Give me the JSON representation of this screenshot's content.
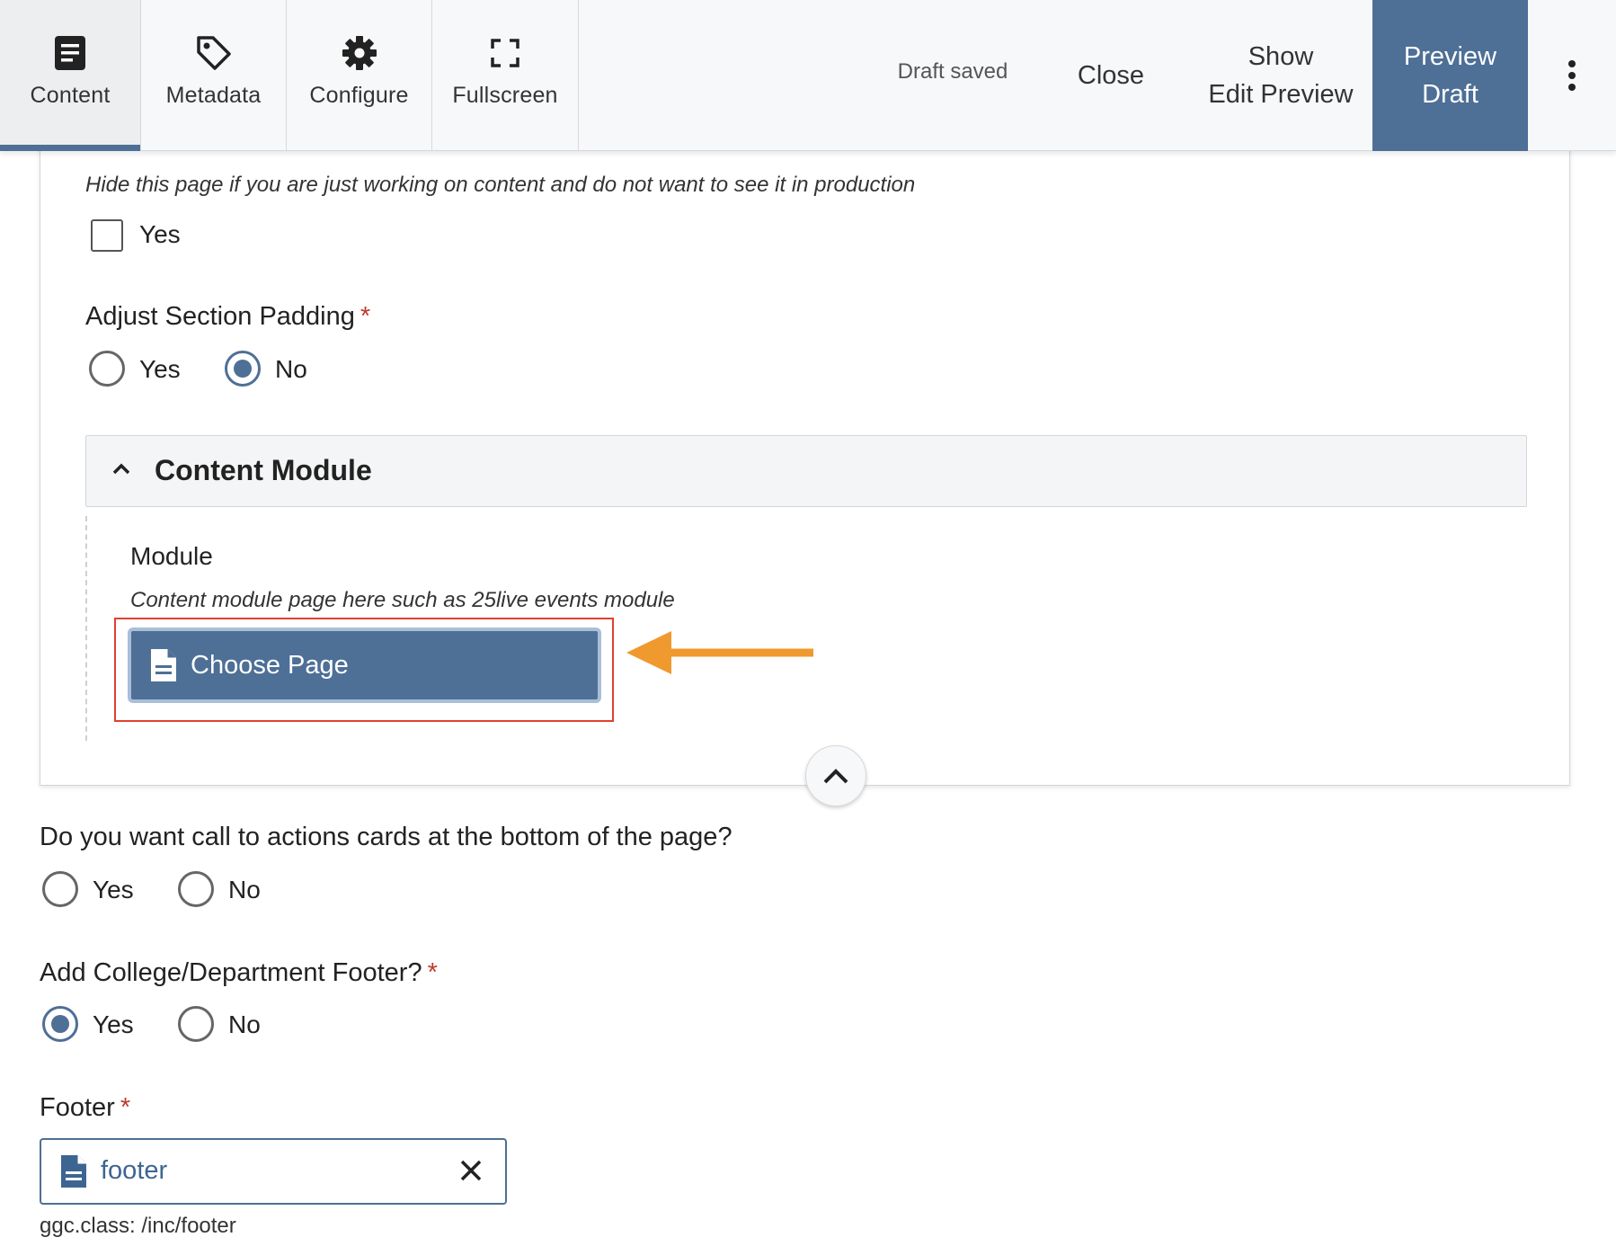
{
  "toolbar": {
    "tabs": [
      {
        "label": "Content",
        "icon": "content-document-icon",
        "active": true
      },
      {
        "label": "Metadata",
        "icon": "tag-icon",
        "active": false
      },
      {
        "label": "Configure",
        "icon": "gear-icon",
        "active": false
      },
      {
        "label": "Fullscreen",
        "icon": "fullscreen-icon",
        "active": false
      }
    ],
    "status": "Draft saved",
    "close_label": "Close",
    "show_preview": {
      "line1": "Show",
      "line2": "Edit Preview"
    },
    "preview_draft": {
      "line1": "Preview",
      "line2": "Draft"
    },
    "more_icon": "kebab-menu-icon"
  },
  "form": {
    "hide_page": {
      "hint": "Hide this page if you are just working on content and do not want to see it in production",
      "option": "Yes",
      "checked": false
    },
    "section_padding": {
      "label": "Adjust Section Padding",
      "required": "*",
      "options": [
        "Yes",
        "No"
      ],
      "selected": "No"
    },
    "content_module": {
      "title": "Content Module",
      "module_label": "Module",
      "module_hint": "Content module page here such as 25live events module",
      "choose_button": "Choose Page"
    },
    "cta_cards": {
      "label": "Do you want call to actions cards at the bottom of the page?",
      "options": [
        "Yes",
        "No"
      ],
      "selected": null
    },
    "dept_footer": {
      "label": "Add College/Department Footer?",
      "required": "*",
      "options": [
        "Yes",
        "No"
      ],
      "selected": "Yes"
    },
    "footer": {
      "label": "Footer",
      "required": "*",
      "value": "footer",
      "path": "ggc.class: /inc/footer"
    }
  },
  "colors": {
    "accent": "#4e6f96",
    "required": "#c0392b",
    "highlight": "#e0402f",
    "arrow": "#f0992f"
  }
}
